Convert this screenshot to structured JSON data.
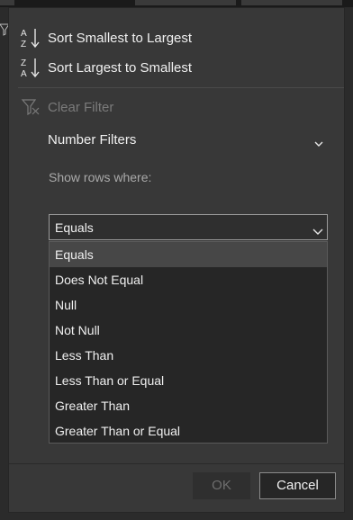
{
  "menu": {
    "sort_asc": {
      "label": "Sort Smallest to Largest",
      "icon": "sort-az-icon"
    },
    "sort_desc": {
      "label": "Sort Largest to Smallest",
      "icon": "sort-za-icon"
    },
    "clear_filter": {
      "label": "Clear Filter",
      "icon": "filter-clear-icon",
      "enabled": false
    },
    "number_filters": {
      "label": "Number Filters",
      "icon": "chevron-down-icon"
    }
  },
  "filter": {
    "show_rows_label": "Show rows where:",
    "operator_selected": "Equals",
    "options": [
      {
        "label": "Equals",
        "highlighted": true
      },
      {
        "label": "Does Not Equal"
      },
      {
        "label": "Null"
      },
      {
        "label": "Not Null"
      },
      {
        "label": "Less Than"
      },
      {
        "label": "Less Than or Equal"
      },
      {
        "label": "Greater Than"
      },
      {
        "label": "Greater Than or Equal"
      }
    ]
  },
  "buttons": {
    "ok": "OK",
    "cancel": "Cancel"
  }
}
